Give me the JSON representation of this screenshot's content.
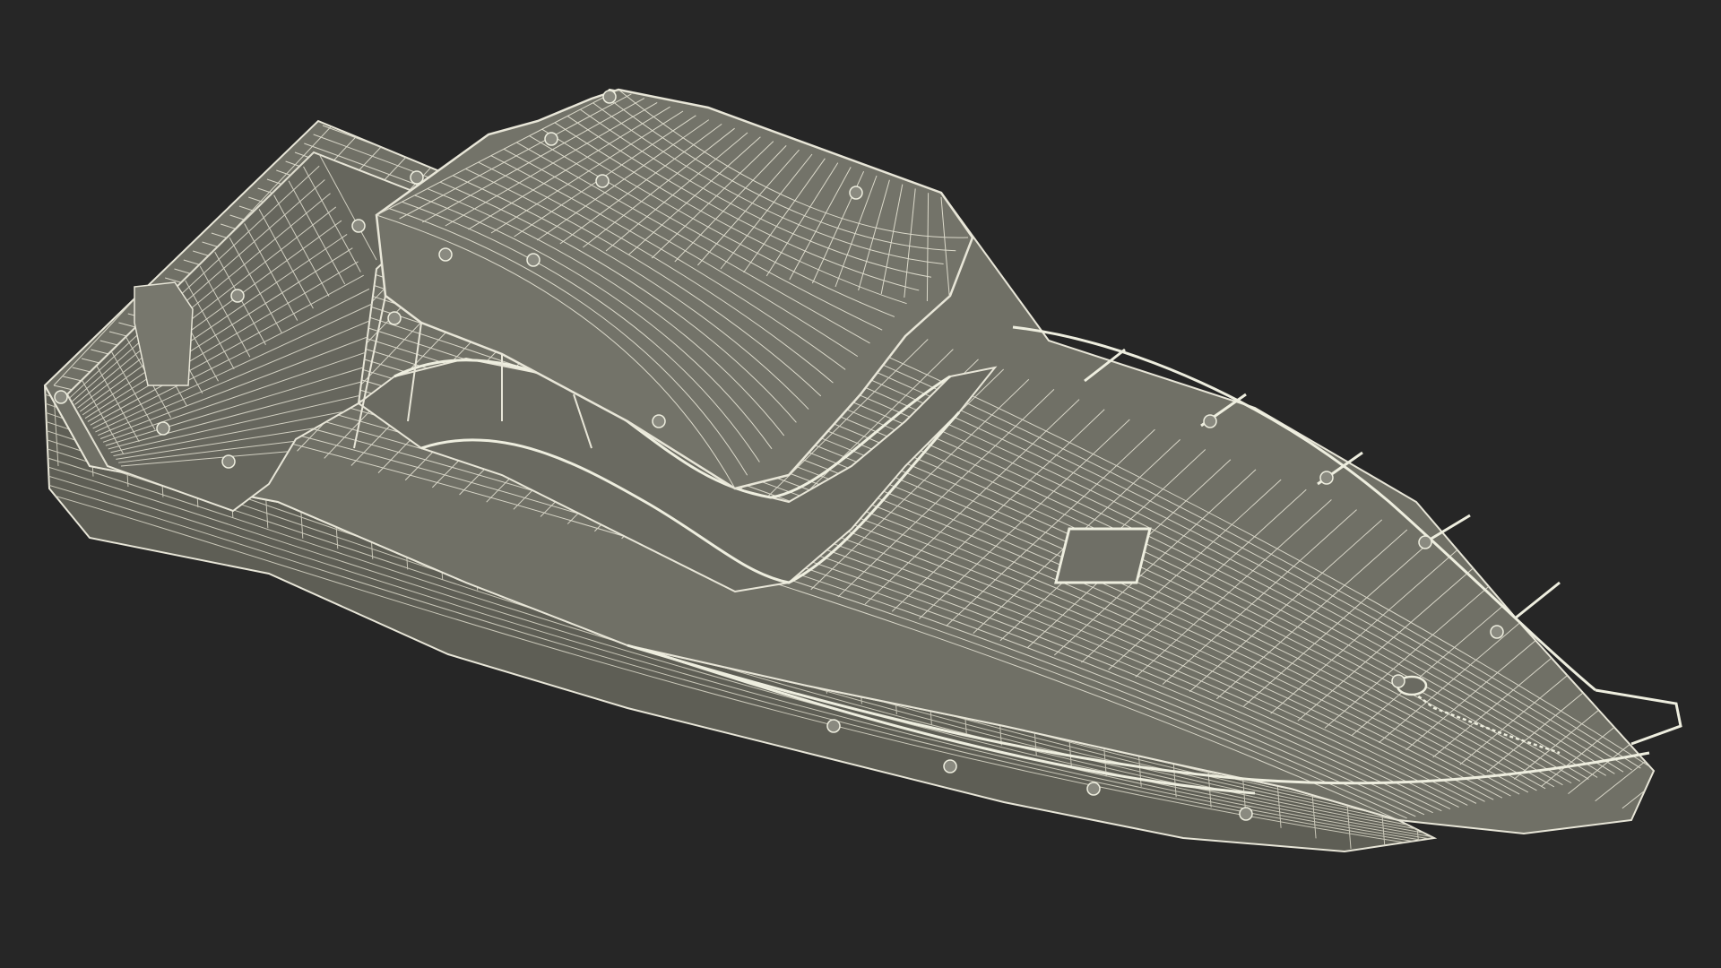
{
  "scene": {
    "subject": "boat-hull-wireframe",
    "colors": {
      "background": "#262626",
      "surface": "#707066",
      "surface_dark": "#5e5e55",
      "surface_light": "#7a7a70",
      "wire": "#e8e6d8",
      "wire_faint": "#c9c7b8"
    }
  }
}
